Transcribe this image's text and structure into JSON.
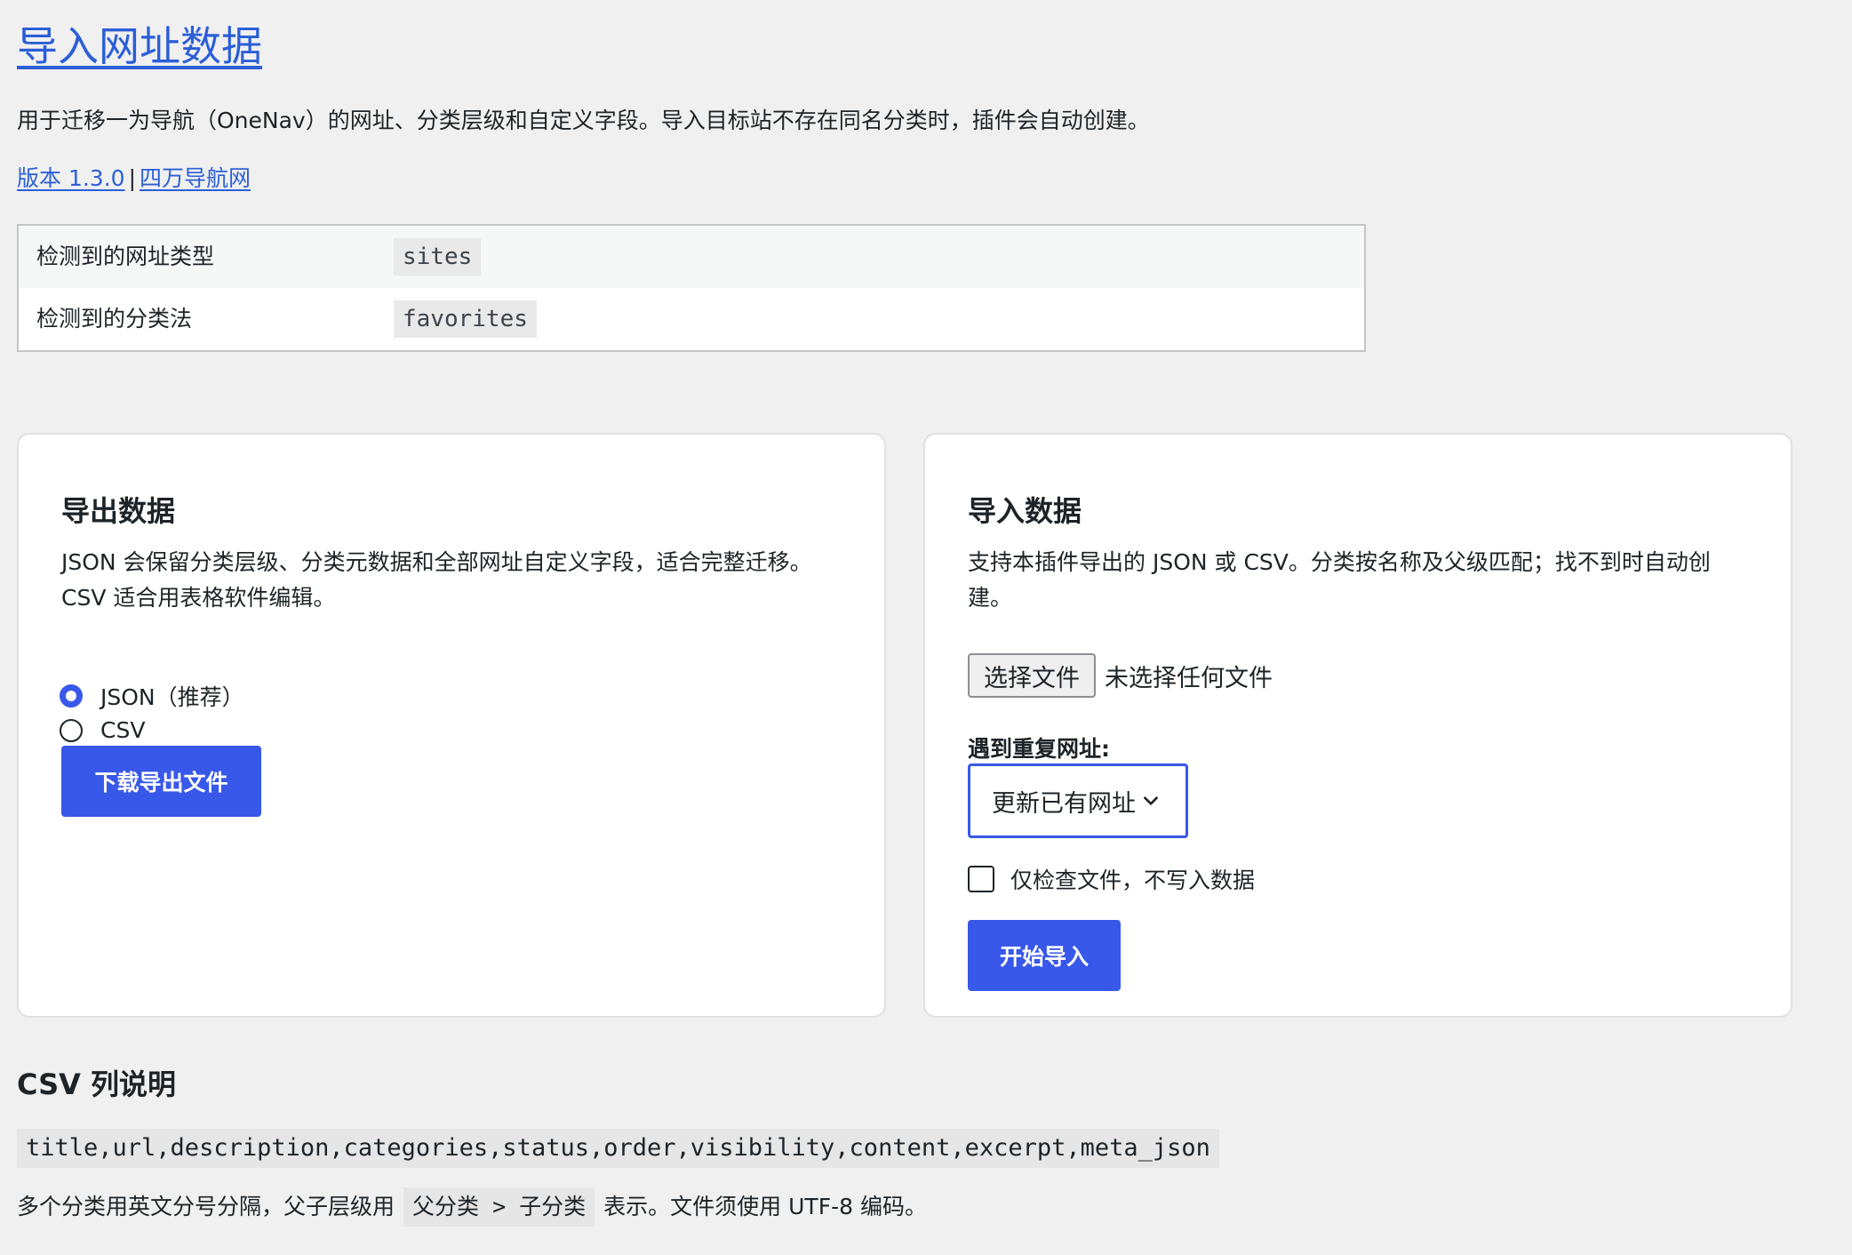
{
  "page": {
    "title": "导入网址数据",
    "intro": "用于迁移一为导航（OneNav）的网址、分类层级和自定义字段。导入目标站不存在同名分类时，插件会自动创建。",
    "version_link": "版本 1.3.0",
    "separator": "|",
    "site_link": "四万导航网"
  },
  "detected": {
    "rows": [
      {
        "label": "检测到的网址类型",
        "value": "sites"
      },
      {
        "label": "检测到的分类法",
        "value": "favorites"
      }
    ]
  },
  "export_card": {
    "title": "导出数据",
    "description": "JSON 会保留分类层级、分类元数据和全部网址自定义字段，适合完整迁移。CSV 适合用表格软件编辑。",
    "formats": [
      {
        "label": "JSON（推荐）",
        "checked": true
      },
      {
        "label": "CSV",
        "checked": false
      }
    ],
    "download_button": "下载导出文件"
  },
  "import_card": {
    "title": "导入数据",
    "description": "支持本插件导出的 JSON 或 CSV。分类按名称及父级匹配；找不到时自动创建。",
    "file_button": "选择文件",
    "file_status": "未选择任何文件",
    "duplicate_label": "遇到重复网址:",
    "duplicate_selected": "更新已有网址",
    "dry_run_label": "仅检查文件，不写入数据",
    "dry_run_checked": false,
    "start_button": "开始导入"
  },
  "csv_help": {
    "title": "CSV 列说明",
    "columns": "title,url,description,categories,status,order,visibility,content,excerpt,meta_json",
    "note_before": "多个分类用英文分号分隔，父子层级用",
    "note_code": "父分类 > 子分类",
    "note_after": "表示。文件须使用 UTF-8 编码。"
  },
  "colors": {
    "accent": "#3858e9",
    "link": "#2c5fd6",
    "background": "#f0f0f1"
  },
  "icons": {
    "select_arrow": "chevron-down-icon"
  }
}
